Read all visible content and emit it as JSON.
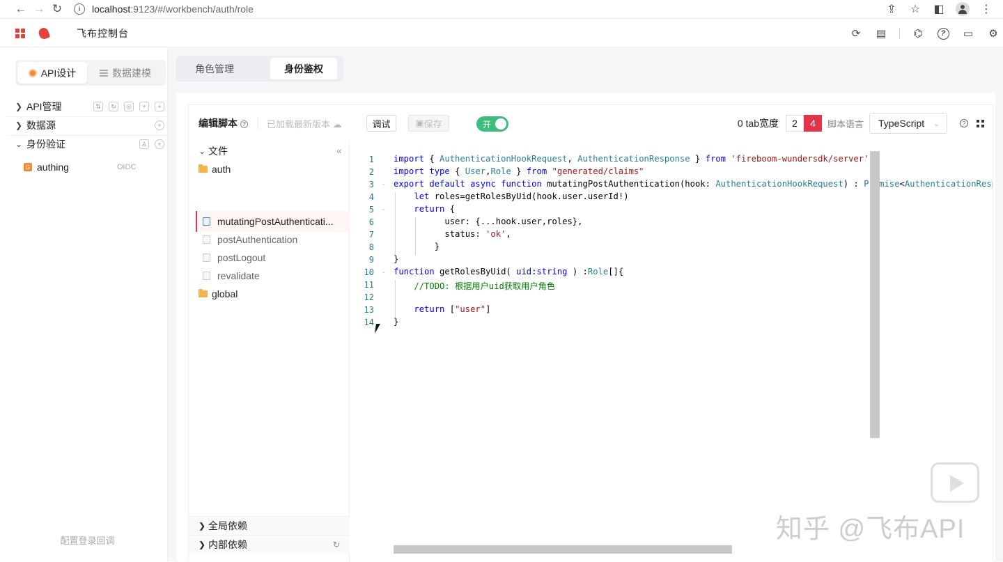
{
  "browser": {
    "url_host": "localhost",
    "url_rest": ":9123/#/workbench/auth/role"
  },
  "app": {
    "title": "飞布控制台"
  },
  "sidebar": {
    "segments": [
      {
        "label": "API设计",
        "active": true
      },
      {
        "label": "数据建模",
        "active": false
      }
    ],
    "sections": [
      {
        "label": "API管理",
        "expanded": false
      },
      {
        "label": "数据源",
        "expanded": false
      },
      {
        "label": "身份验证",
        "expanded": true
      }
    ],
    "auth_items": [
      {
        "name": "authing",
        "type": "OIDC"
      }
    ],
    "footer_link": "配置登录回调"
  },
  "main": {
    "tabs": [
      {
        "label": "角色管理",
        "active": false
      },
      {
        "label": "身份鉴权",
        "active": true
      }
    ]
  },
  "toolbar": {
    "title": "编辑脚本",
    "loaded_status": "已加载最新版本",
    "debug_label": "调试",
    "save_label": "保存",
    "toggle_label": "开",
    "toggle_on": true,
    "tab_width_label": "0  tab宽度",
    "tab_options": [
      "2",
      "4"
    ],
    "tab_selected": "4",
    "lang_label": "脚本语言",
    "lang_value": "TypeScript"
  },
  "file_tree": {
    "root_label": "文件",
    "folders": [
      {
        "name": "auth",
        "files": [
          {
            "name": "mutatingPostAuthenticati...",
            "active": true
          },
          {
            "name": "postAuthentication",
            "active": false
          },
          {
            "name": "postLogout",
            "active": false
          },
          {
            "name": "revalidate",
            "active": false
          }
        ]
      },
      {
        "name": "global",
        "files": []
      }
    ],
    "global_deps": "全局依赖",
    "internal_deps": "内部依赖"
  },
  "code": {
    "line_numbers": [
      "1",
      "2",
      "3",
      "4",
      "5",
      "6",
      "7",
      "8",
      "9",
      "10",
      "11",
      "12",
      "13",
      "14"
    ]
  },
  "colors": {
    "accent_red": "#e5334a",
    "toggle_green": "#3dbd7d",
    "brand_orange": "#f08a3a"
  },
  "watermark": "知乎 @飞布API"
}
